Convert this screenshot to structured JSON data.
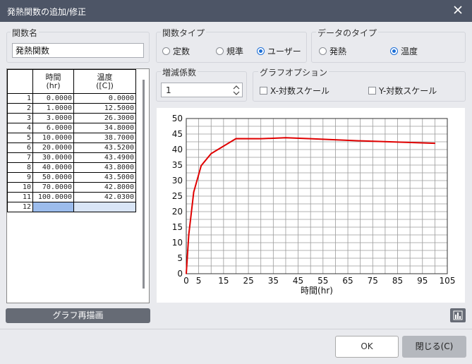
{
  "window": {
    "title": "発熱関数の追加/修正"
  },
  "name_group": {
    "label": "関数名",
    "value": "発熱関数"
  },
  "func_type": {
    "label": "関数タイプ",
    "options": [
      {
        "label": "定数",
        "selected": false
      },
      {
        "label": "規準",
        "selected": false
      },
      {
        "label": "ユーザー",
        "selected": true
      }
    ]
  },
  "data_type": {
    "label": "データのタイプ",
    "options": [
      {
        "label": "発熱",
        "selected": false
      },
      {
        "label": "温度",
        "selected": true
      }
    ]
  },
  "multiplier": {
    "label": "増減係数",
    "value": "1"
  },
  "graph_options": {
    "label": "グラフオプション",
    "x_log": "X-対数スケール",
    "y_log": "Y-対数スケール"
  },
  "table": {
    "headers": [
      "時間\n(hr)",
      "温度\n([C])"
    ],
    "rows": [
      [
        "1",
        "0.0000",
        "0.0000"
      ],
      [
        "2",
        "1.0000",
        "12.5000"
      ],
      [
        "3",
        "3.0000",
        "26.3000"
      ],
      [
        "4",
        "6.0000",
        "34.8000"
      ],
      [
        "5",
        "10.0000",
        "38.7000"
      ],
      [
        "6",
        "20.0000",
        "43.5200"
      ],
      [
        "7",
        "30.0000",
        "43.4900"
      ],
      [
        "8",
        "40.0000",
        "43.8000"
      ],
      [
        "9",
        "50.0000",
        "43.5000"
      ],
      [
        "10",
        "70.0000",
        "42.8000"
      ],
      [
        "11",
        "100.0000",
        "42.0300"
      ],
      [
        "12",
        "",
        ""
      ]
    ]
  },
  "buttons": {
    "redraw": "グラフ再描画",
    "ok": "OK",
    "close": "閉じる(C)"
  },
  "chart_data": {
    "type": "line",
    "xlabel": "時間(hr)",
    "ylabel": "",
    "xlim": [
      0,
      105
    ],
    "ylim": [
      0,
      50
    ],
    "x_ticks": [
      "0",
      "5",
      "15",
      "25",
      "35",
      "45",
      "55",
      "65",
      "75",
      "85",
      "95",
      "105"
    ],
    "y_ticks": [
      "0",
      "5",
      "10",
      "15",
      "20",
      "25",
      "30",
      "35",
      "40",
      "45",
      "50"
    ],
    "grid": true,
    "line_color": "#e00000",
    "series": [
      {
        "x": [
          0,
          1,
          3,
          6,
          10,
          20,
          30,
          40,
          50,
          70,
          100
        ],
        "y": [
          0,
          12.5,
          26.3,
          34.8,
          38.7,
          43.52,
          43.49,
          43.8,
          43.5,
          42.8,
          42.03
        ]
      }
    ]
  },
  "icons": {
    "close": "close-icon",
    "chart": "chart-icon"
  }
}
